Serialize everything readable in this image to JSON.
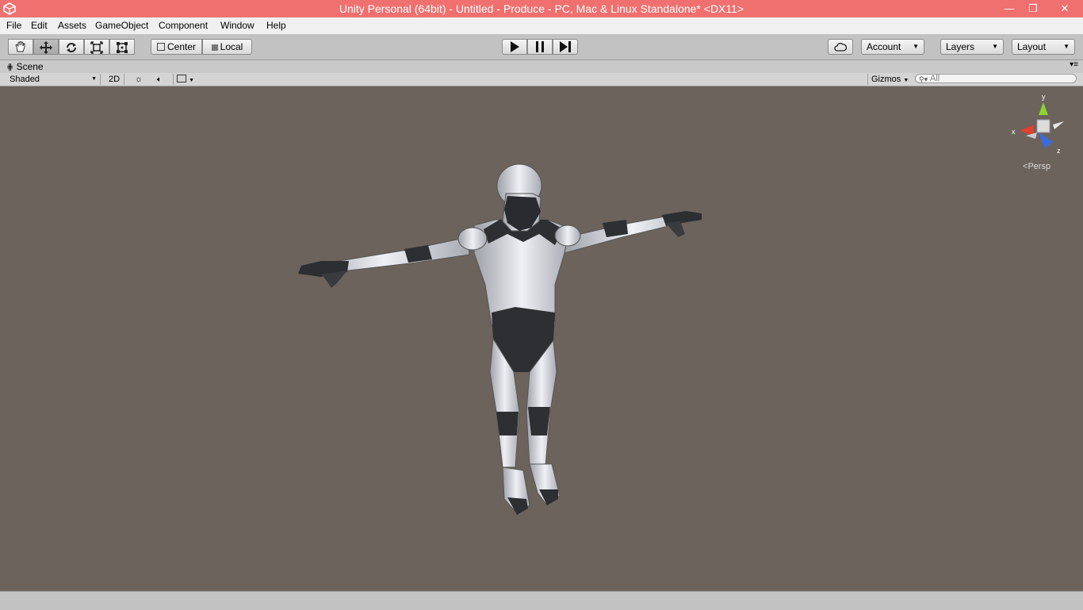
{
  "window": {
    "title": "Unity Personal (64bit) - Untitled - Produce - PC, Mac & Linux Standalone* <DX11>",
    "minimize_glyph": "—",
    "maximize_glyph": "❐",
    "close_glyph": "✕"
  },
  "menu": {
    "items": [
      "File",
      "Edit",
      "Assets",
      "GameObject",
      "Component",
      "Window",
      "Help"
    ]
  },
  "toolbar": {
    "pivot_label": "Center",
    "space_label": "Local",
    "account_label": "Account",
    "layers_label": "Layers",
    "layout_label": "Layout"
  },
  "scene": {
    "tab_label": "Scene",
    "shading_mode": "Shaded",
    "mode_2d_label": "2D",
    "gizmos_label": "Gizmos",
    "search_placeholder": "All",
    "projection_label": "Persp",
    "axis_x": "x",
    "axis_y": "y",
    "axis_z": "z"
  },
  "colors": {
    "title_bar": "#f0706f",
    "viewport_bg": "#6b635c",
    "toolbar_bg": "#c2c2c2",
    "axis_x": "#e0402e",
    "axis_y": "#8bd32e",
    "axis_z": "#3a6be0"
  }
}
